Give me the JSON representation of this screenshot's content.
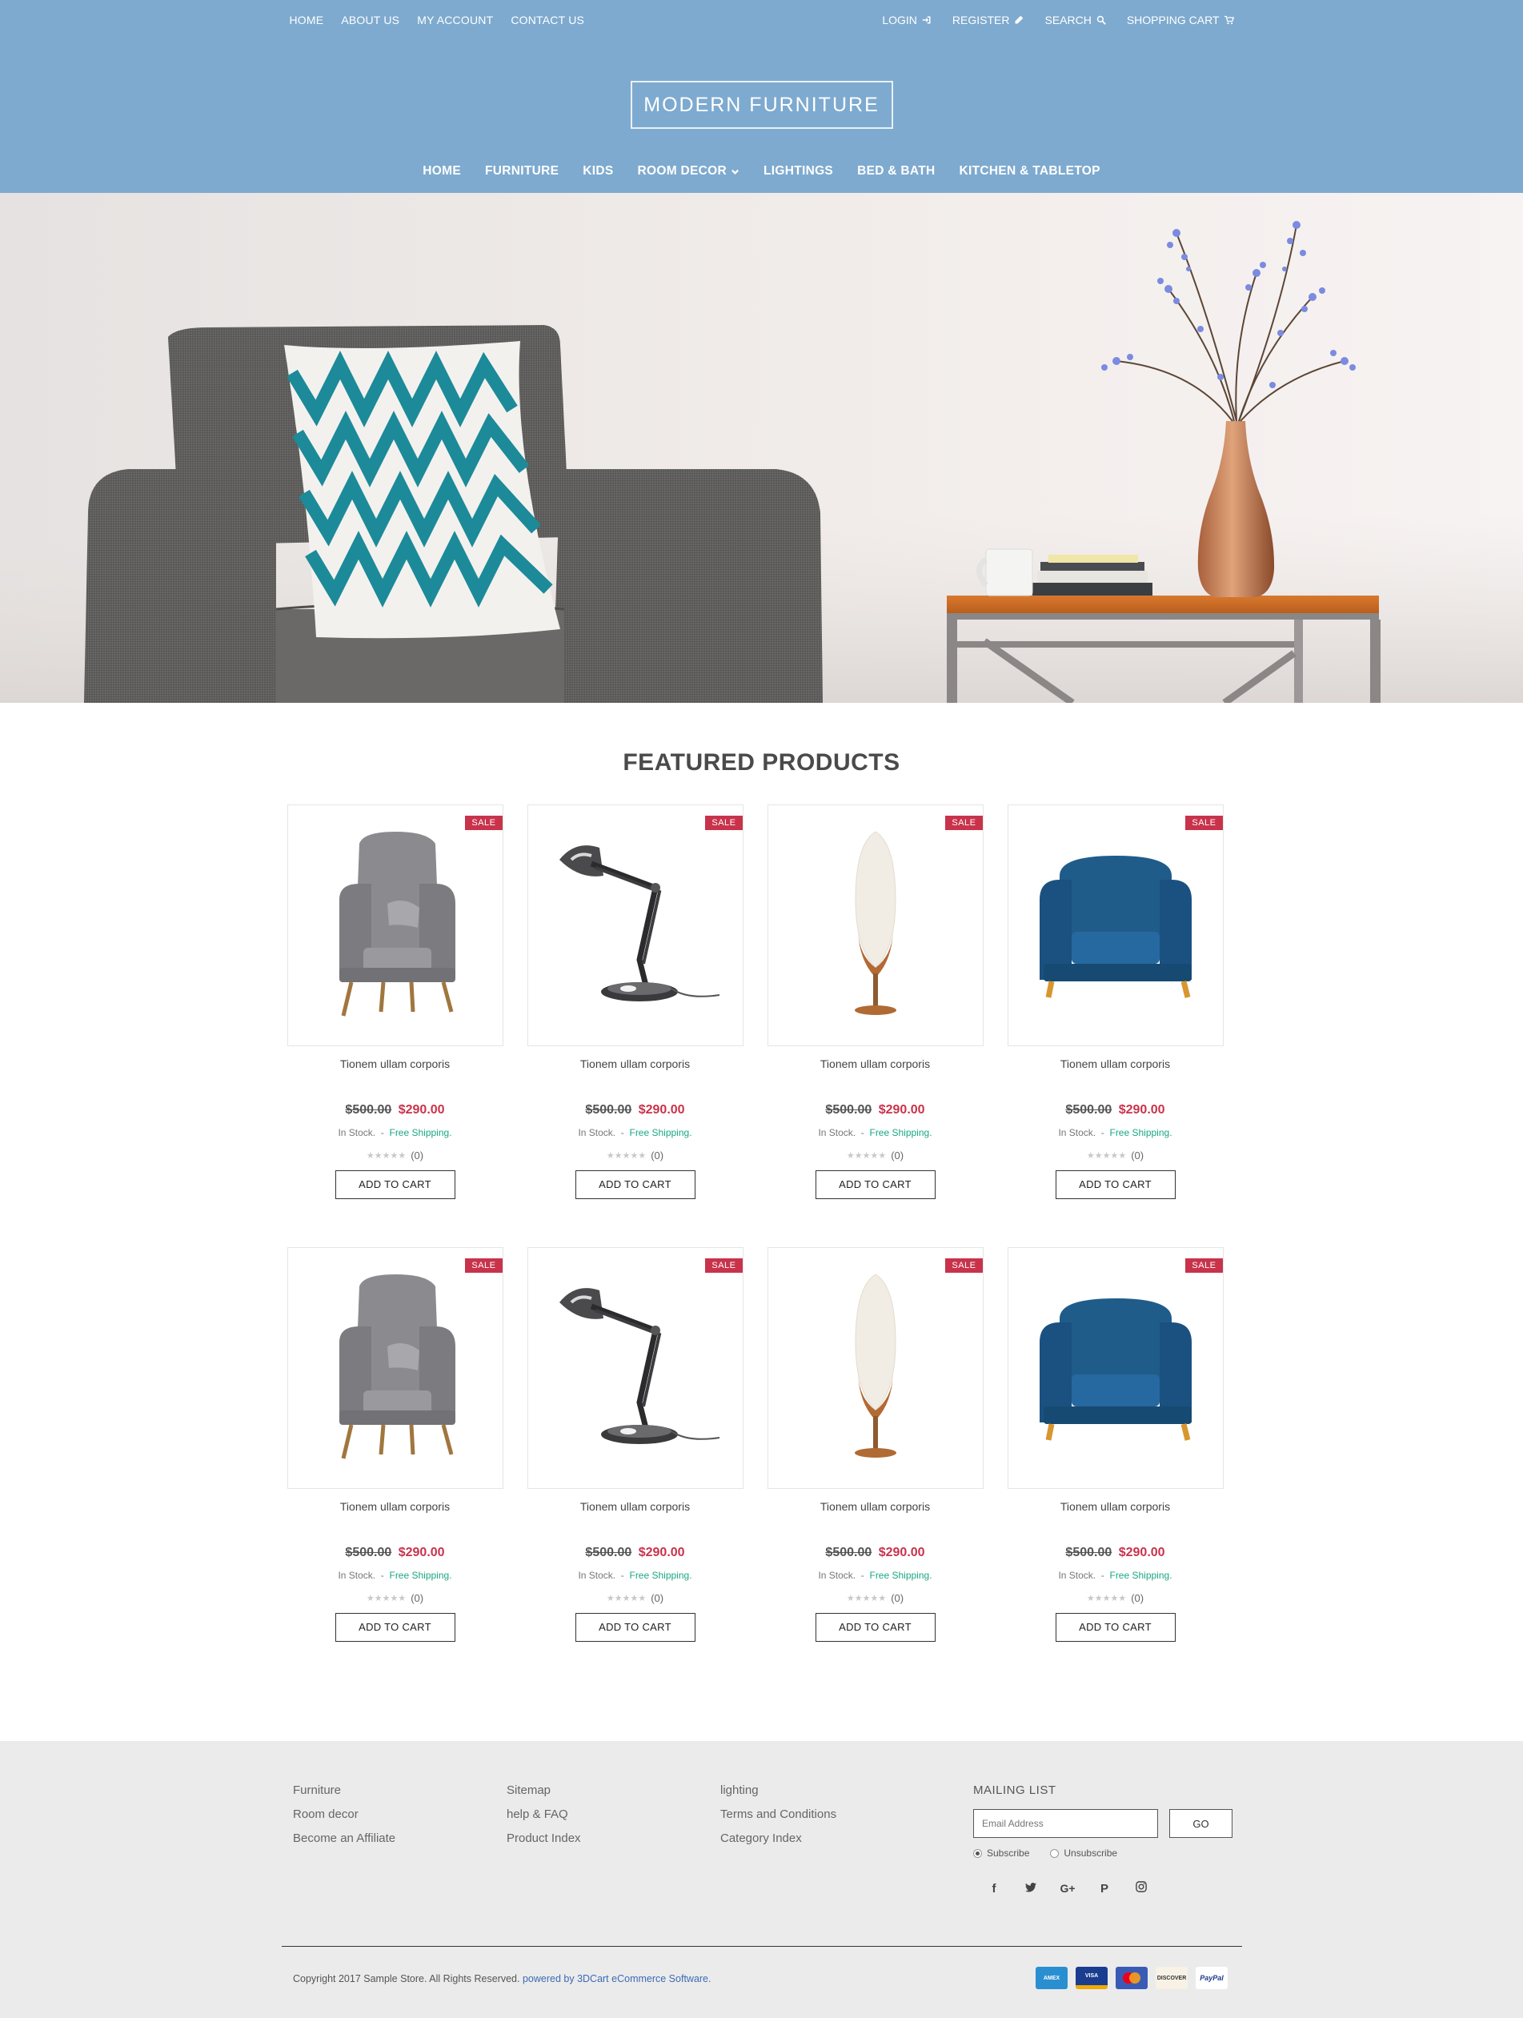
{
  "topbar": {
    "links": [
      "HOME",
      "ABOUT US",
      "MY ACCOUNT",
      "CONTACT US"
    ],
    "login": "LOGIN",
    "register": "REGISTER",
    "search": "SEARCH",
    "cart": "SHOPPING CART"
  },
  "logo": "MODERN FURNITURE",
  "mainnav": [
    "HOME",
    "FURNITURE",
    "KIDS",
    "ROOM DECOR",
    "LIGHTINGS",
    "BED & BATH",
    "KITCHEN & TABLETOP"
  ],
  "featured": {
    "title": "FEATURED PRODUCTS",
    "sale_label": "SALE",
    "products": [
      {
        "name": "Tionem ullam corporis",
        "old_price": "$500.00",
        "price": "$290.00",
        "stock": "In Stock.",
        "shipping": "Free Shipping.",
        "reviews": "(0)",
        "button": "ADD TO CART",
        "image": "wingback-chair-gray"
      },
      {
        "name": "Tionem ullam corporis",
        "old_price": "$500.00",
        "price": "$290.00",
        "stock": "In Stock.",
        "shipping": "Free Shipping.",
        "reviews": "(0)",
        "button": "ADD TO CART",
        "image": "desk-lamp-chrome"
      },
      {
        "name": "Tionem ullam corporis",
        "old_price": "$500.00",
        "price": "$290.00",
        "stock": "In Stock.",
        "shipping": "Free Shipping.",
        "reviews": "(0)",
        "button": "ADD TO CART",
        "image": "floor-lamp-white"
      },
      {
        "name": "Tionem ullam corporis",
        "old_price": "$500.00",
        "price": "$290.00",
        "stock": "In Stock.",
        "shipping": "Free Shipping.",
        "reviews": "(0)",
        "button": "ADD TO CART",
        "image": "armchair-blue"
      },
      {
        "name": "Tionem ullam corporis",
        "old_price": "$500.00",
        "price": "$290.00",
        "stock": "In Stock.",
        "shipping": "Free Shipping.",
        "reviews": "(0)",
        "button": "ADD TO CART",
        "image": "wingback-chair-gray"
      },
      {
        "name": "Tionem ullam corporis",
        "old_price": "$500.00",
        "price": "$290.00",
        "stock": "In Stock.",
        "shipping": "Free Shipping.",
        "reviews": "(0)",
        "button": "ADD TO CART",
        "image": "desk-lamp-chrome"
      },
      {
        "name": "Tionem ullam corporis",
        "old_price": "$500.00",
        "price": "$290.00",
        "stock": "In Stock.",
        "shipping": "Free Shipping.",
        "reviews": "(0)",
        "button": "ADD TO CART",
        "image": "floor-lamp-white"
      },
      {
        "name": "Tionem ullam corporis",
        "old_price": "$500.00",
        "price": "$290.00",
        "stock": "In Stock.",
        "shipping": "Free Shipping.",
        "reviews": "(0)",
        "button": "ADD TO CART",
        "image": "armchair-blue"
      }
    ]
  },
  "footer": {
    "col1": [
      "Furniture",
      "Room decor",
      "Become an Affiliate"
    ],
    "col2": [
      "Sitemap",
      "help & FAQ",
      "Product Index"
    ],
    "col3": [
      "lighting",
      "Terms and Conditions",
      "Category Index"
    ],
    "mailing_title": "MAILING LIST",
    "email_placeholder": "Email Address",
    "go": "GO",
    "subscribe": "Subscribe",
    "unsubscribe": "Unsubscribe",
    "copyright": "Copyright 2017 Sample Store. All Rights Reserved.",
    "powered": "powered by 3DCart eCommerce Software.",
    "payments": [
      "AMEX",
      "VISA",
      "MC",
      "DISCOVER",
      "PayPal"
    ]
  },
  "colors": {
    "header_bg": "#7eaacf",
    "sale": "#c8334b",
    "shipping": "#1aa783",
    "footer_bg": "#ebebeb",
    "link": "#3b6bb5"
  }
}
